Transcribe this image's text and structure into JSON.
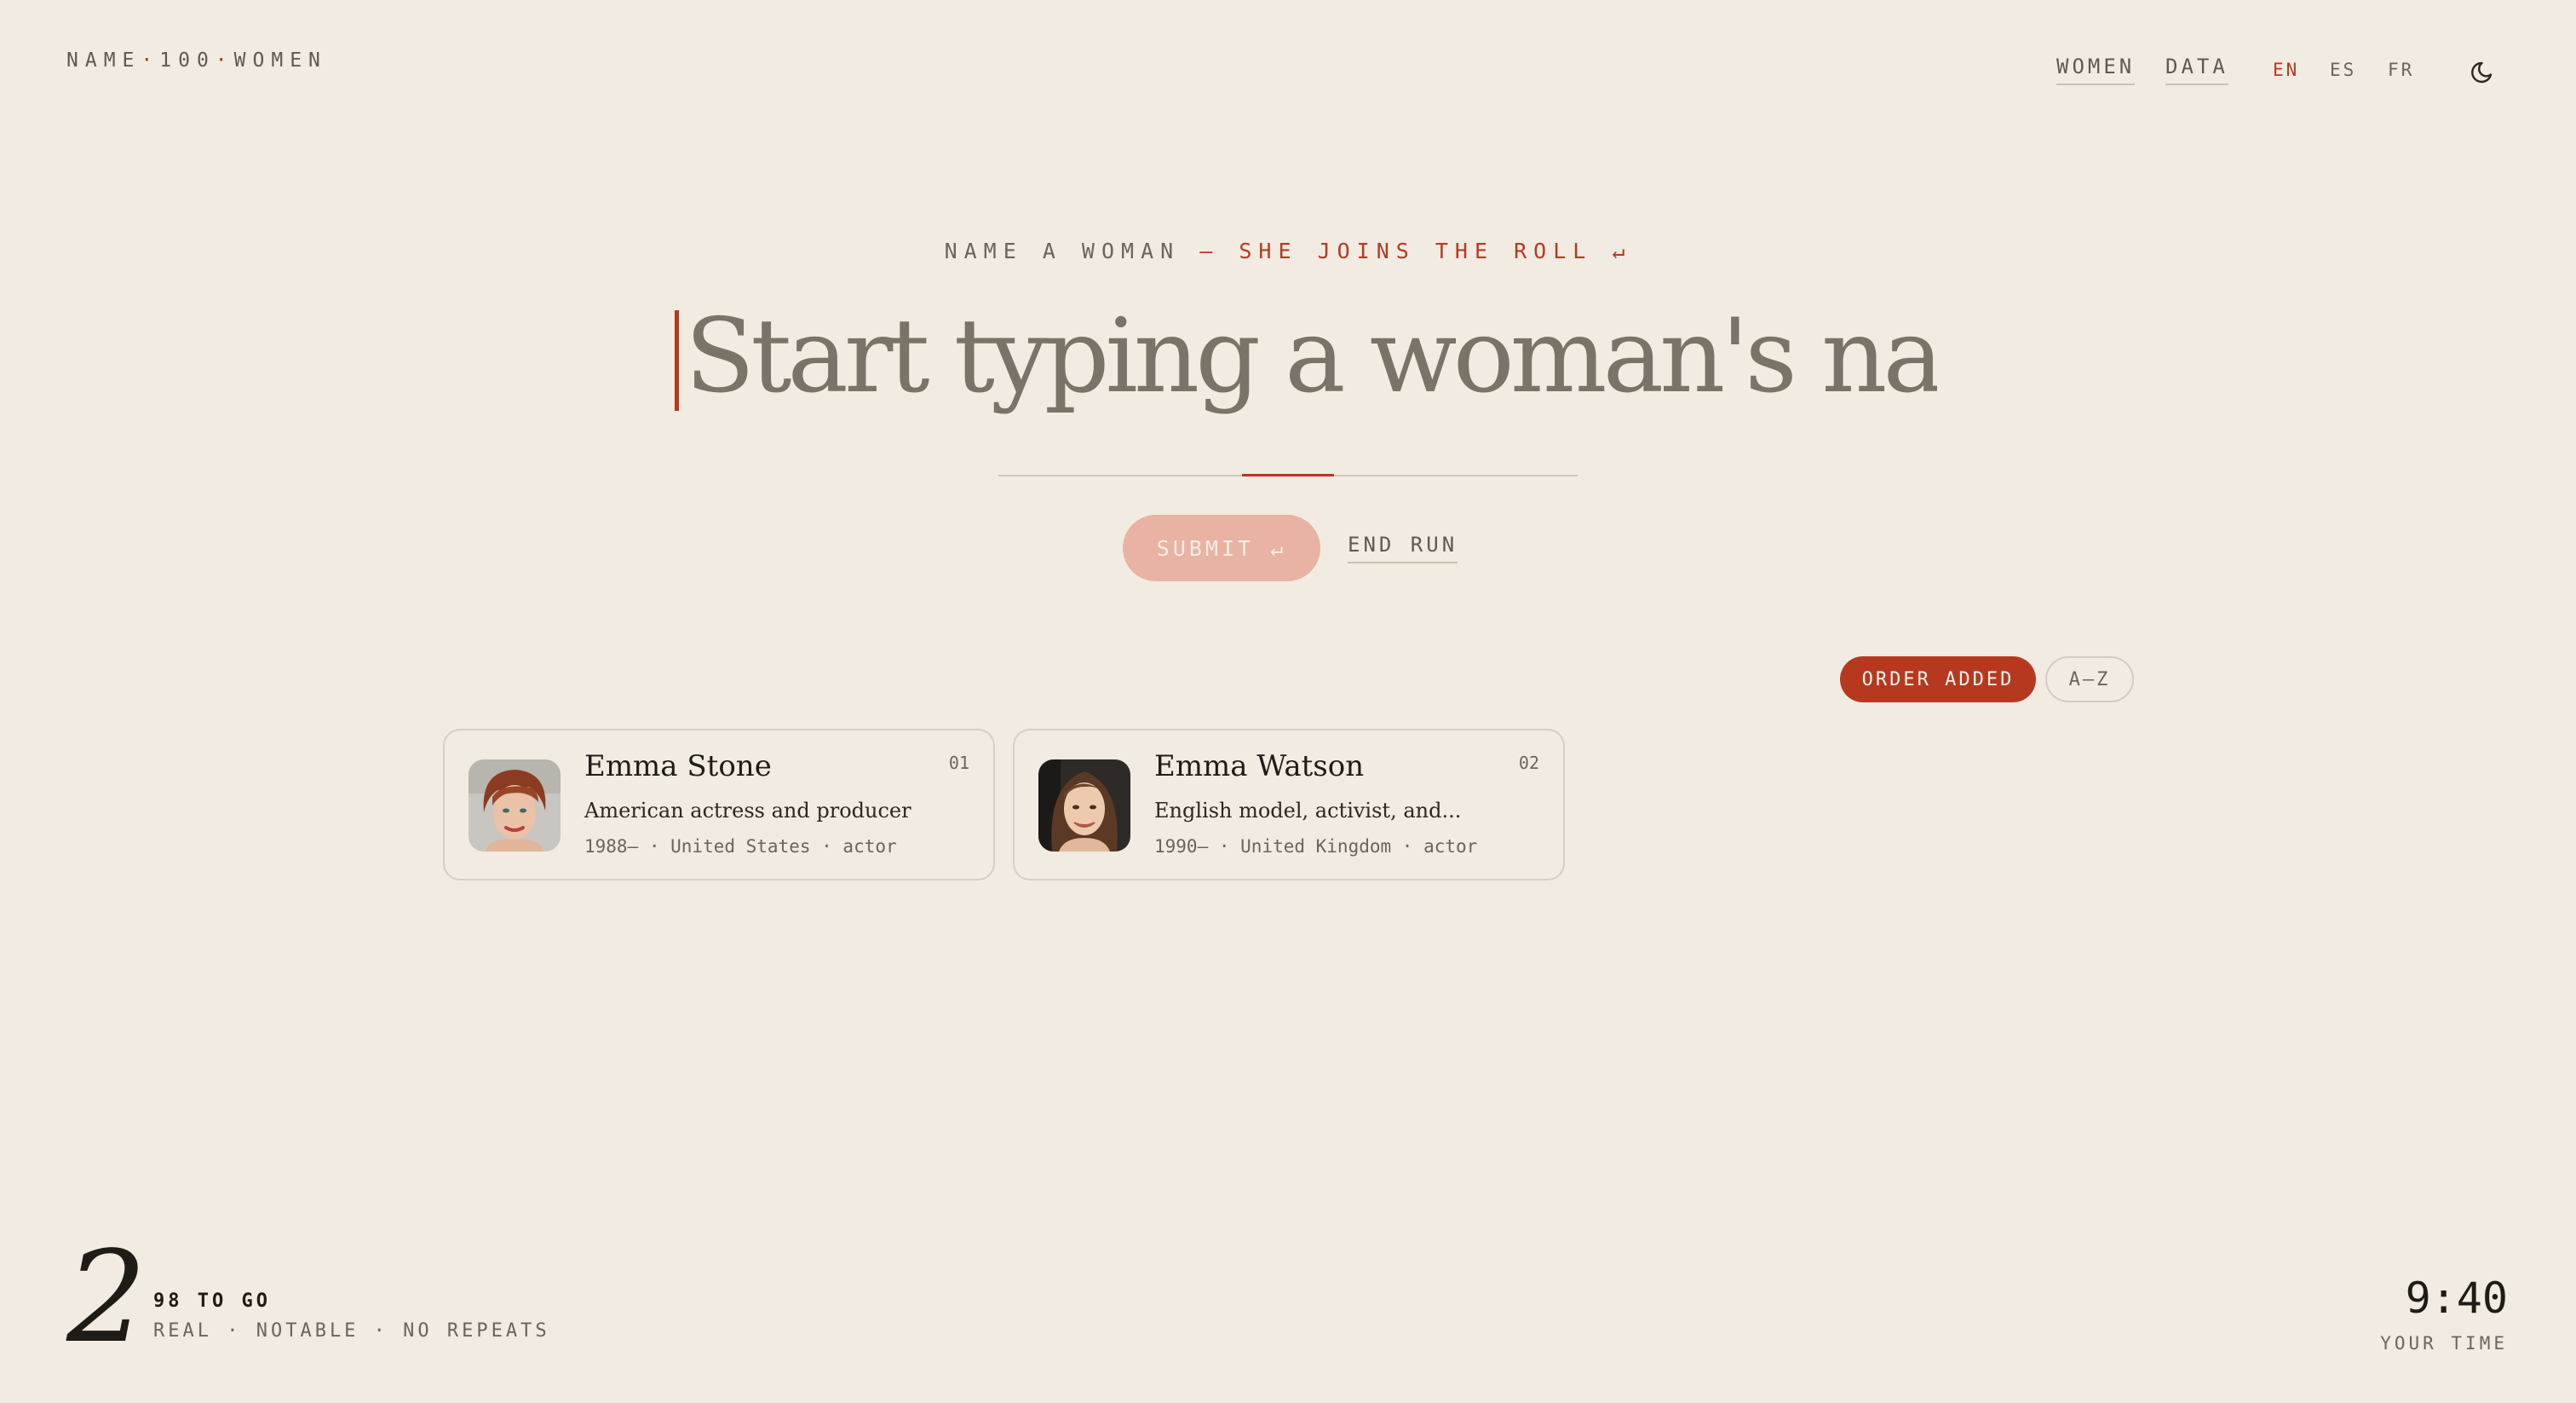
{
  "brand": {
    "part1": "NAME",
    "sep": "·",
    "part2": "100",
    "part3": "WOMEN"
  },
  "nav": {
    "women": "WOMEN",
    "data": "DATA",
    "languages": [
      "EN",
      "ES",
      "FR"
    ],
    "active_language": "EN",
    "theme_icon": "moon-icon"
  },
  "hero": {
    "eyebrow_prefix": "NAME A WOMAN",
    "eyebrow_accent": "— SHE JOINS THE ROLL ↵",
    "input_placeholder": "Start typing a woman's name",
    "input_value": "",
    "submit_label": "SUBMIT ↵",
    "end_run_label": "END RUN"
  },
  "sort": {
    "order_added": "ORDER ADDED",
    "alpha": "A–Z",
    "active": "ORDER ADDED"
  },
  "women": [
    {
      "name": "Emma Stone",
      "description": "American actress and producer",
      "meta": "1988– · United States · actor",
      "number": "01"
    },
    {
      "name": "Emma Watson",
      "description": "English model, activist, and...",
      "meta": "1990– · United Kingdom · actor",
      "number": "02"
    }
  ],
  "footer": {
    "count": "2",
    "to_go": "98 TO GO",
    "rules": "REAL · NOTABLE · NO REPEATS",
    "timer": "9:40",
    "timer_label": "YOUR TIME"
  },
  "colors": {
    "background": "#f1ebe1",
    "accent": "#b6391f",
    "submit_disabled": "#e8b3a2",
    "text": "#1f1c17",
    "muted": "#6a645b"
  }
}
